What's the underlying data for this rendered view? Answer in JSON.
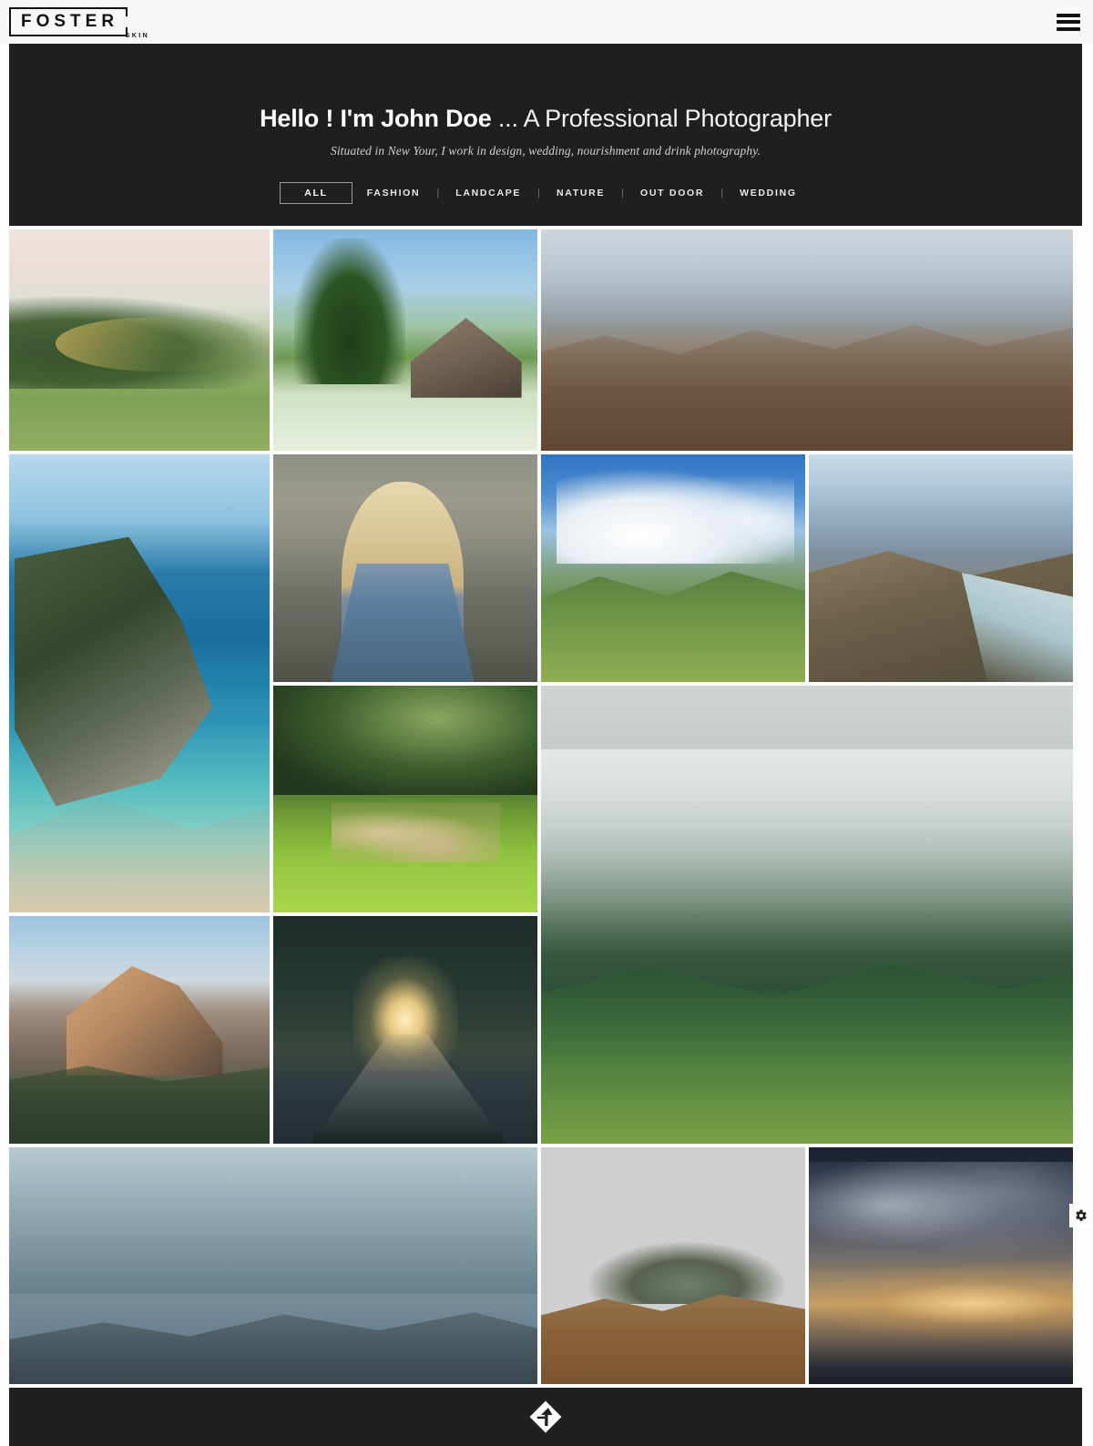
{
  "header": {
    "logo": {
      "name": "FOSTER",
      "sub": "SKIN",
      "icon": "brand-logo"
    },
    "menu_icon": "hamburger-menu-icon"
  },
  "hero": {
    "title_strong": "Hello ! I'm John Doe",
    "title_rest": " ... A Professional Photographer",
    "subtitle": "Situated in New Your, I work in design, wedding, nourishment and drink photography.",
    "background_color": "#1f1f1f",
    "text_color": "#ffffff"
  },
  "filters": {
    "active": "ALL",
    "separator": "|",
    "items": [
      {
        "label": "ALL",
        "active": true
      },
      {
        "label": "FASHION",
        "active": false
      },
      {
        "label": "LANDCAPE",
        "active": false
      },
      {
        "label": "NATURE",
        "active": false
      },
      {
        "label": "OUT DOOR",
        "active": false
      },
      {
        "label": "WEDDING",
        "active": false
      }
    ]
  },
  "gallery": {
    "items": [
      {
        "id": 1,
        "alt": "Rolling green hills with winding road under pale sky"
      },
      {
        "id": 2,
        "alt": "Wooden cabin in a white flower meadow with conifers"
      },
      {
        "id": 3,
        "alt": "Arid rocky mountain ridge with hazy blue layers"
      },
      {
        "id": 4,
        "alt": "Coastal cliff with turquoise sea and beach"
      },
      {
        "id": 5,
        "alt": "Blonde woman seen from behind overlooking a hazy vista"
      },
      {
        "id": 6,
        "alt": "Green mountain valley beneath towering cumulus clouds"
      },
      {
        "id": 7,
        "alt": "Winding cliff road above a lake with distant snow peaks"
      },
      {
        "id": 8,
        "alt": "Deer standing in a sunlit green meadow before a forest"
      },
      {
        "id": 9,
        "alt": "Misty forested hillside with a low band of fog"
      },
      {
        "id": 10,
        "alt": "Granite dome mountain glowing at dusk"
      },
      {
        "id": 11,
        "alt": "Dark tree-lined road with sun glare at the far end"
      },
      {
        "id": 12,
        "alt": "Two hikers standing on rock before a granite wall"
      },
      {
        "id": 13,
        "alt": "Volcanic caldera under a teal sky"
      },
      {
        "id": 14,
        "alt": "Dramatic dark sunset clouds over the horizon"
      }
    ]
  },
  "settings_badge": {
    "icon": "gear-icon"
  },
  "footer": {
    "logo_icon": "diamond-f-logo",
    "background_color": "#1f1f1f"
  }
}
